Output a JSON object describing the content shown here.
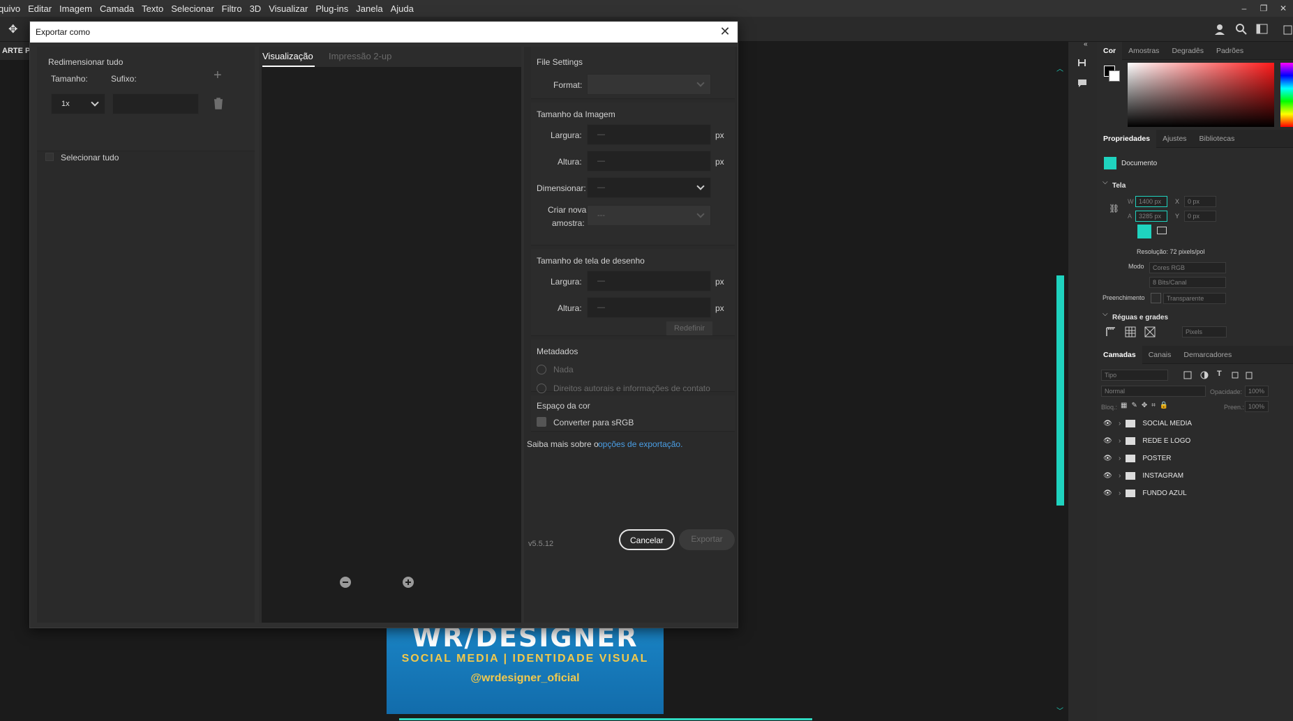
{
  "menu": [
    "quivo",
    "Editar",
    "Imagem",
    "Camada",
    "Texto",
    "Selecionar",
    "Filtro",
    "3D",
    "Visualizar",
    "Plug-ins",
    "Janela",
    "Ajuda"
  ],
  "window_controls": [
    "–",
    "❐",
    "✕"
  ],
  "doc_tab": "ARTE PA",
  "artwork": {
    "brand": "WR/DESIGNER",
    "tagline": "SOCIAL MEDIA | IDENTIDADE VISUAL",
    "handle": "@wrdesigner_oficial",
    "color": "#1a84c5",
    "accent": "#f2c94c"
  },
  "dialog": {
    "title": "Exportar como",
    "left": {
      "heading": "Redimensionar tudo",
      "size_label": "Tamanho:",
      "suffix_label": "Sufixo:",
      "scale_value": "1x",
      "select_all": "Selecionar tudo"
    },
    "tabs": {
      "preview": "Visualização",
      "twoup": "Impressão 2-up"
    },
    "file_settings": {
      "heading": "File Settings",
      "format_label": "Format:",
      "format_value": ""
    },
    "image_size": {
      "heading": "Tamanho da Imagem",
      "width_label": "Largura:",
      "width_value": "—",
      "width_unit": "px",
      "height_label": "Altura:",
      "height_value": "—",
      "height_unit": "px",
      "scale_label": "Dimensionar:",
      "scale_value": "—",
      "resample_label_1": "Criar nova",
      "resample_label_2": "amostra:",
      "resample_value": "---"
    },
    "canvas_size": {
      "heading": "Tamanho de tela de desenho",
      "width_label": "Largura:",
      "width_value": "—",
      "width_unit": "px",
      "height_label": "Altura:",
      "height_value": "—",
      "height_unit": "px",
      "reset": "Redefinir"
    },
    "metadata": {
      "heading": "Metadados",
      "none": "Nada",
      "copyright": "Direitos autorais e informações de contato"
    },
    "color_space": {
      "heading": "Espaço da cor",
      "convert": "Converter para sRGB"
    },
    "learn_more_prefix": "Saiba mais sobre o",
    "learn_more_link": "opções de exportação.",
    "version": "v5.5.12",
    "cancel": "Cancelar",
    "export": "Exportar",
    "link_color": "#4a9fe6"
  },
  "color_panel": {
    "tabs": [
      "Cor",
      "Amostras",
      "Degradês",
      "Padrões"
    ]
  },
  "properties_panel": {
    "tabs": [
      "Propriedades",
      "Ajustes",
      "Bibliotecas"
    ],
    "doc_label": "Documento",
    "section_canvas": "Tela",
    "w_label": "W",
    "w_value": "1400 px",
    "x_label": "X",
    "x_value": "0 px",
    "a_label": "A",
    "a_value": "3285 px",
    "y_label": "Y",
    "y_value": "0 px",
    "resolution": "Resolução: 72 pixels/pol",
    "mode_label": "Modo",
    "mode_value": "Cores RGB",
    "bits_value": "8 Bits/Canal",
    "fill_label": "Preenchimento",
    "fill_value": "Transparente",
    "section_rulers": "Réguas e grades",
    "units_value": "Pixels",
    "accent": "#1fd3bf"
  },
  "layers_panel": {
    "tabs": [
      "Camadas",
      "Canais",
      "Demarcadores"
    ],
    "filter_placeholder": "Tipo",
    "blend_mode": "Normal",
    "opacity_label": "Opacidade:",
    "opacity_value": "100%",
    "lock_label": "Bloq.:",
    "fill_label": "Preen.:",
    "fill_value": "100%",
    "layers": [
      "SOCIAL MEDIA",
      "REDE E LOGO",
      "POSTER",
      "INSTAGRAM",
      "FUNDO AZUL"
    ]
  }
}
